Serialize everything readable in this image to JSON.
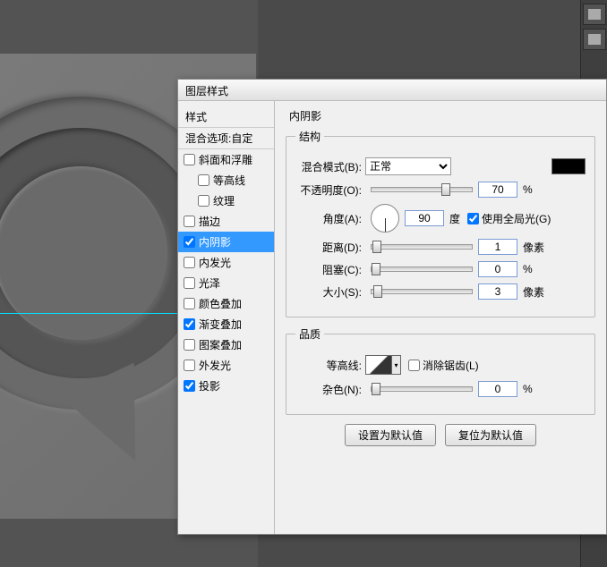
{
  "dialog": {
    "title": "图层样式",
    "styles_header": "样式",
    "styles_subheader": "混合选项:自定",
    "style_items": [
      {
        "label": "斜面和浮雕",
        "checked": false,
        "indented": false
      },
      {
        "label": "等高线",
        "checked": false,
        "indented": true
      },
      {
        "label": "纹理",
        "checked": false,
        "indented": true
      },
      {
        "label": "描边",
        "checked": false,
        "indented": false
      },
      {
        "label": "内阴影",
        "checked": true,
        "indented": false,
        "selected": true
      },
      {
        "label": "内发光",
        "checked": false,
        "indented": false
      },
      {
        "label": "光泽",
        "checked": false,
        "indented": false
      },
      {
        "label": "颜色叠加",
        "checked": false,
        "indented": false
      },
      {
        "label": "渐变叠加",
        "checked": true,
        "indented": false
      },
      {
        "label": "图案叠加",
        "checked": false,
        "indented": false
      },
      {
        "label": "外发光",
        "checked": false,
        "indented": false
      },
      {
        "label": "投影",
        "checked": true,
        "indented": false
      }
    ]
  },
  "settings": {
    "panel_title": "内阴影",
    "structure_legend": "结构",
    "blend_mode_label": "混合模式(B):",
    "blend_mode_value": "正常",
    "opacity_label": "不透明度(O):",
    "opacity_value": "70",
    "opacity_unit": "%",
    "angle_label": "角度(A):",
    "angle_value": "90",
    "angle_unit": "度",
    "global_light_label": "使用全局光(G)",
    "distance_label": "距离(D):",
    "distance_value": "1",
    "distance_unit": "像素",
    "choke_label": "阻塞(C):",
    "choke_value": "0",
    "choke_unit": "%",
    "size_label": "大小(S):",
    "size_value": "3",
    "size_unit": "像素",
    "quality_legend": "品质",
    "contour_label": "等高线:",
    "antialias_label": "消除锯齿(L)",
    "noise_label": "杂色(N):",
    "noise_value": "0",
    "noise_unit": "%",
    "btn_default": "设置为默认值",
    "btn_reset": "复位为默认值"
  }
}
